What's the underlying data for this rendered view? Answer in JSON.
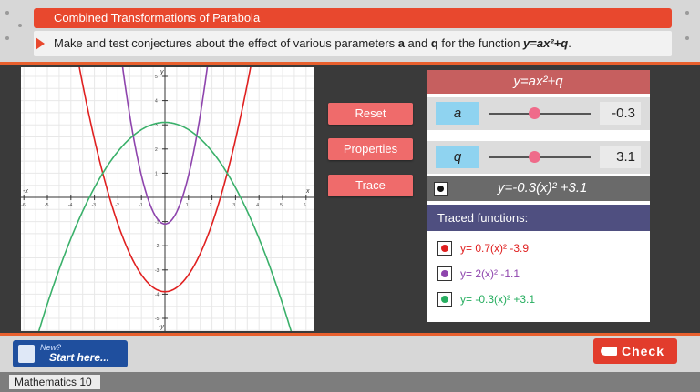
{
  "header": {
    "title": "Combined Transformations of Parabola",
    "instruction_pre": "Make and test conjectures about the effect of various parameters ",
    "param_a": "a",
    "instruction_mid": " and ",
    "param_q": "q",
    "instruction_post": " for the function ",
    "function": "y=ax²+q",
    "instruction_end": "."
  },
  "buttons": {
    "reset": "Reset",
    "properties": "Properties",
    "trace": "Trace"
  },
  "panel": {
    "heading": "y=ax²+q",
    "a_label": "a",
    "a_value": "-0.3",
    "a_fraction": 0.45,
    "q_label": "q",
    "q_value": "3.1",
    "q_fraction": 0.45,
    "current_function": "y=-0.3(x)² +3.1",
    "traced_heading": "Traced functions:",
    "traced": [
      {
        "text": "y= 0.7(x)² -3.9",
        "color": "#e02020"
      },
      {
        "text": "y= 2(x)² -1.1",
        "color": "#8e44ad"
      },
      {
        "text": "y= -0.3(x)² +3.1",
        "color": "#27ae60"
      }
    ]
  },
  "graph": {
    "x_axis_label": "x",
    "x_axis_label_neg": "-x",
    "y_axis_label": "y",
    "y_axis_label_neg": "-y",
    "xlim": [
      -6,
      6
    ],
    "ylim": [
      -6,
      6
    ],
    "curves": [
      {
        "a": 0.7,
        "q": -3.9,
        "color": "#e02020"
      },
      {
        "a": 2,
        "q": -1.1,
        "color": "#8e44ad"
      },
      {
        "a": -0.3,
        "q": 3.1,
        "color": "#3ab06a"
      }
    ]
  },
  "footer": {
    "start_new": "New?",
    "start_label": "Start here...",
    "check_label": "Check",
    "course": "Mathematics 10"
  }
}
